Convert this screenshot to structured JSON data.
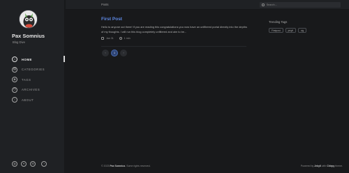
{
  "sidebar": {
    "site_title": "Pax Somnius",
    "tagline": "Blog Dive",
    "nav": [
      {
        "label": "HOME",
        "icon": "home-icon",
        "glyph": "⌂",
        "active": true
      },
      {
        "label": "CATEGORIES",
        "icon": "categories-icon",
        "glyph": "▤",
        "active": false
      },
      {
        "label": "TAGS",
        "icon": "tags-icon",
        "glyph": "◈",
        "active": false
      },
      {
        "label": "ARCHIVES",
        "icon": "archives-icon",
        "glyph": "◷",
        "active": false
      },
      {
        "label": "ABOUT",
        "icon": "about-icon",
        "glyph": "i",
        "active": false
      }
    ],
    "social": [
      {
        "icon": "github-icon",
        "glyph": "◍"
      },
      {
        "icon": "twitter-icon",
        "glyph": "✦"
      },
      {
        "icon": "email-icon",
        "glyph": "✉"
      },
      {
        "icon": "rss-icon",
        "glyph": "◔"
      }
    ]
  },
  "topbar": {
    "breadcrumb": "Posts",
    "search_placeholder": "Search..."
  },
  "posts": [
    {
      "title": "First Post",
      "excerpt": "Hello to anyone out there! If you are reading this congratulations you now have an unfiltered portal directly into the depths of my thoughts. I will run this blog completely unfiltered and aim to be...",
      "date": "Jan 31",
      "read_time": "1 min"
    }
  ],
  "pagination": {
    "prev": "‹",
    "current": "1",
    "next": "›"
  },
  "trending": {
    "title": "Trending Tags",
    "tags": [
      "Firstpost",
      "jekyll",
      "cig"
    ]
  },
  "footer": {
    "copyright_prefix": "© 2023",
    "owner": "Pax Somnius",
    "copyright_suffix": ". Some rights reserved.",
    "powered_prefix": "Powered by",
    "engine": "Jekyll",
    "with_text": "with",
    "theme": "Chirpy",
    "theme_suffix": "theme."
  },
  "colors": {
    "accent": "#5f8ae6",
    "background": "#18191b",
    "sidebar": "#1f2124"
  }
}
